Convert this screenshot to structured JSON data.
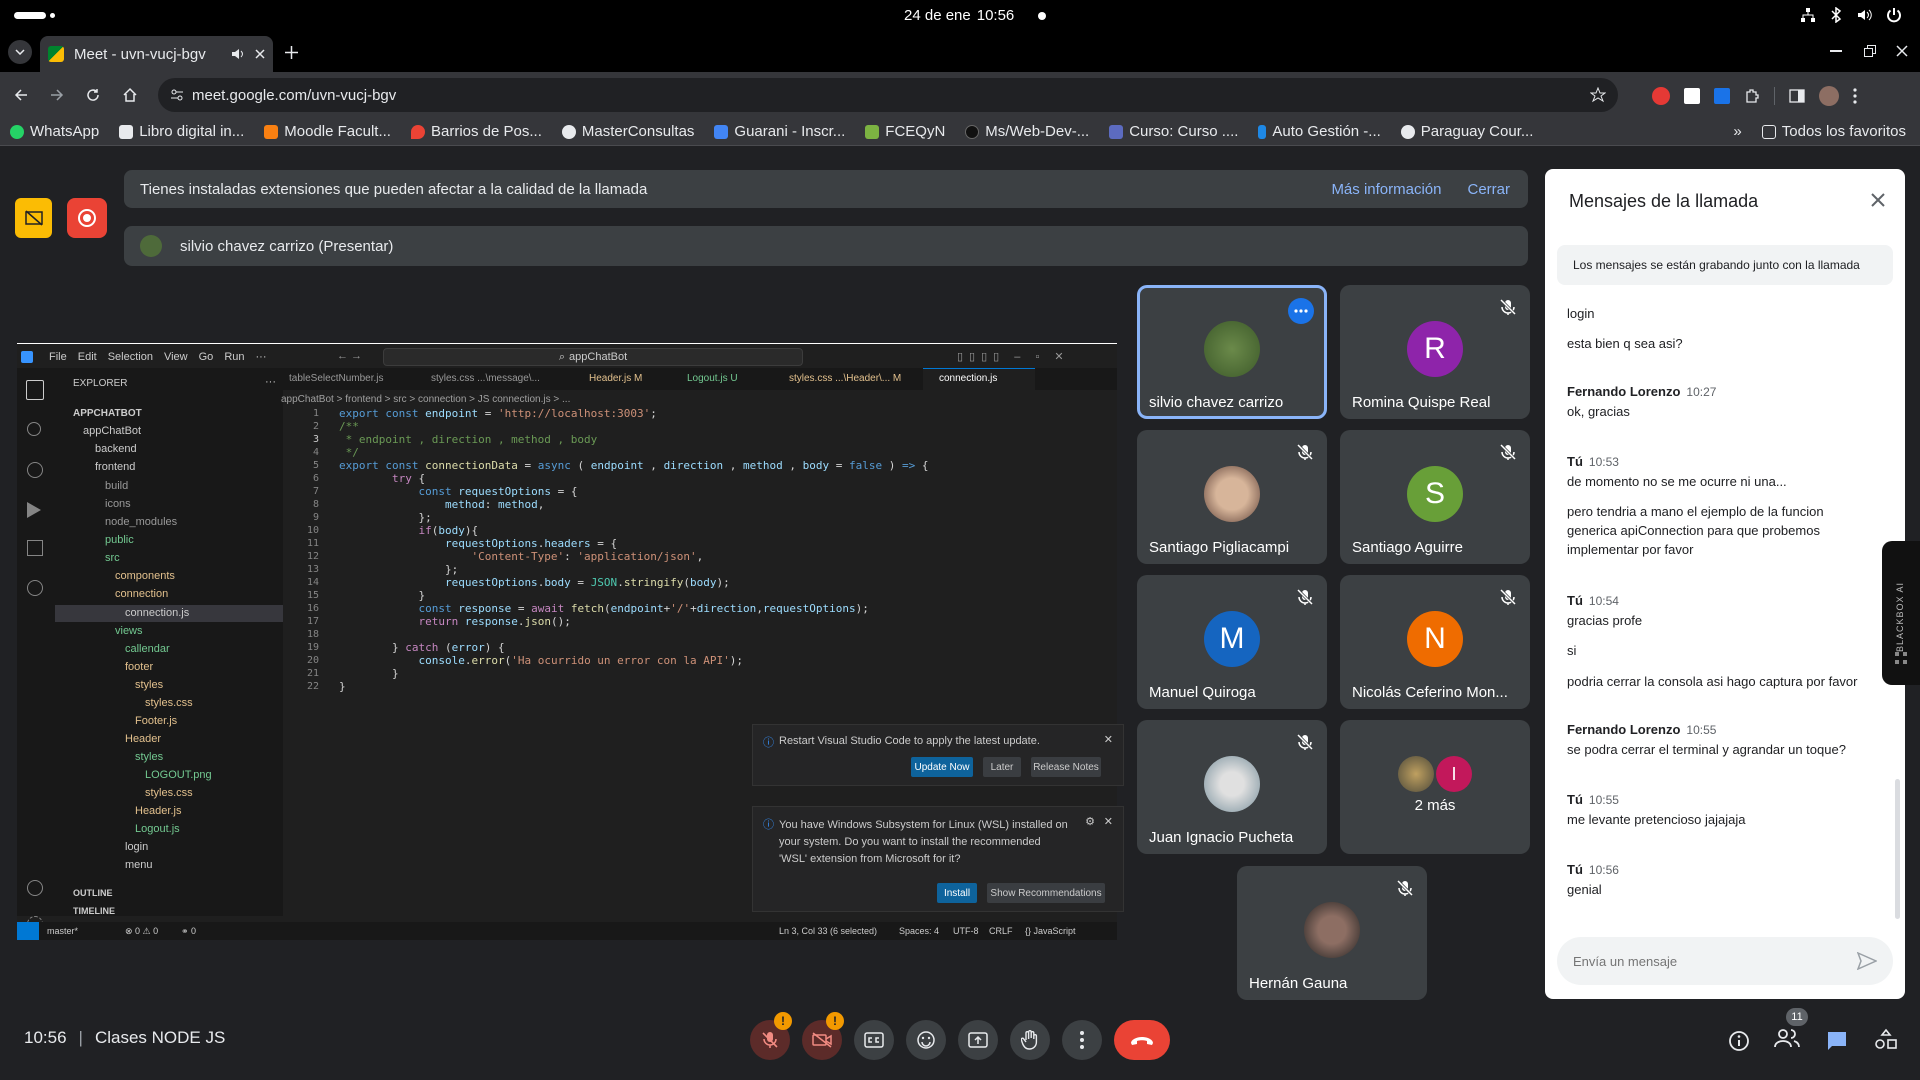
{
  "os": {
    "date": "24 de ene",
    "time": "10:56"
  },
  "browser": {
    "tab_title": "Meet - uvn-vucj-bgv",
    "url": "meet.google.com/uvn-vucj-bgv",
    "bookmarks": [
      "WhatsApp",
      "Libro digital in...",
      "Moodle Facult...",
      "Barrios de Pos...",
      "MasterConsultas",
      "Guarani - Inscr...",
      "FCEQyN",
      "Ms/Web-Dev-...",
      "Curso: Curso ....",
      "Auto Gestión -...",
      "Paraguay Cour..."
    ],
    "all_bookmarks": "Todos los favoritos"
  },
  "meet": {
    "banner_text": "Tienes instaladas extensiones que pueden afectar a la calidad de la llamada",
    "banner_more": "Más información",
    "banner_close": "Cerrar",
    "presenter": "silvio chavez carrizo (Presentar)",
    "participants": [
      {
        "name": "silvio chavez carrizo",
        "avatar": "photo"
      },
      {
        "name": "Romina Quispe Real",
        "avatar": "R",
        "color": "#8e24aa"
      },
      {
        "name": "Santiago Pigliacampi",
        "avatar": "photo"
      },
      {
        "name": "Santiago Aguirre",
        "avatar": "S",
        "color": "#689f38"
      },
      {
        "name": "Manuel Quiroga",
        "avatar": "M",
        "color": "#1565c0"
      },
      {
        "name": "Nicolás Ceferino Mon...",
        "avatar": "N",
        "color": "#ef6c00"
      },
      {
        "name": "Juan Ignacio Pucheta",
        "avatar": "photo"
      },
      {
        "name": "2 más",
        "avatar": "I",
        "color": "#c2185b"
      },
      {
        "name": "Hernán Gauna",
        "avatar": "photo"
      }
    ],
    "clock": "10:56",
    "meeting_name": "Clases NODE JS",
    "people_count": "11"
  },
  "chat": {
    "title": "Mensajes de la llamada",
    "notice": "Los mensajes se están grabando junto con la llamada",
    "partial": "login",
    "messages": [
      {
        "text": "esta bien q sea asi?"
      },
      {
        "author": "Fernando Lorenzo",
        "time": "10:27",
        "text": "ok, gracias"
      },
      {
        "author": "Tú",
        "time": "10:53",
        "text": "de momento no se me ocurre ni una..."
      },
      {
        "text": "pero tendria a mano el ejemplo de la funcion generica apiConnection para que probemos implementar por favor"
      },
      {
        "author": "Tú",
        "time": "10:54",
        "text": "gracias profe"
      },
      {
        "text": "si"
      },
      {
        "text": "podria cerrar la consola asi hago captura por favor"
      },
      {
        "author": "Fernando Lorenzo",
        "time": "10:55",
        "text": "se podra cerrar el terminal y agrandar un toque?"
      },
      {
        "author": "Tú",
        "time": "10:55",
        "text": "me levante pretencioso jajajaja"
      },
      {
        "author": "Tú",
        "time": "10:56",
        "text": "genial"
      }
    ],
    "placeholder": "Envía un mensaje",
    "side_label": "BLACKBOX AI"
  },
  "vscode": {
    "menu": [
      "File",
      "Edit",
      "Selection",
      "View",
      "Go",
      "Run",
      "···"
    ],
    "search": "appChatBot",
    "tabs": [
      "tableSelectNumber.js",
      "styles.css ...\\message\\...",
      "Header.js M",
      "Logout.js U",
      "styles.css ...\\Header\\... M",
      "connection.js"
    ],
    "breadcrumb": "appChatBot > frontend > src > connection > JS connection.js > ...",
    "explorer_title": "EXPLORER",
    "tree": [
      "APPCHATBOT",
      "appChatBot",
      "backend",
      "frontend",
      "build",
      "icons",
      "node_modules",
      "public",
      "src",
      "components",
      "connection",
      "connection.js",
      "views",
      "callendar",
      "footer",
      "styles",
      "styles.css",
      "Footer.js",
      "Header",
      "styles",
      "LOGOUT.png",
      "styles.css",
      "Header.js",
      "Logout.js",
      "login",
      "menu"
    ],
    "outline": "OUTLINE",
    "timeline": "TIMELINE",
    "status_left": "master*",
    "status_errors": "⊗ 0 ⚠ 0",
    "status_ports": "⚭ 0",
    "status_right": [
      "Ln 3, Col 33 (6 selected)",
      "Spaces: 4",
      "UTF-8",
      "CRLF",
      "{} JavaScript"
    ],
    "notif1": "Restart Visual Studio Code to apply the latest update.",
    "notif1_buttons": [
      "Update Now",
      "Later",
      "Release Notes"
    ],
    "notif2": "You have Windows Subsystem for Linux (WSL) installed on your system. Do you want to install the recommended 'WSL' extension from Microsoft for it?",
    "notif2_buttons": [
      "Install",
      "Show Recommendations"
    ]
  }
}
